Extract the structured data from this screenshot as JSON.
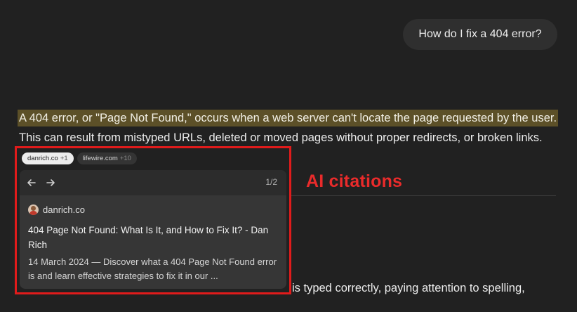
{
  "user_message": "How do I fix a 404 error?",
  "answer": {
    "line1_highlighted": "A 404 error, or \"Page Not Found,\" occurs when a web server can't locate the page requested by the user.",
    "line2": "This can result from mistyped URLs, deleted or moved pages without proper redirects, or broken links.",
    "partial_bottom": "is typed correctly, paying attention to spelling,"
  },
  "citation_chips": [
    {
      "label": "danrich.co",
      "count": "+1"
    },
    {
      "label": "lifewire.com",
      "count": "+10"
    }
  ],
  "citation_card": {
    "pager": "1/2",
    "source": "danrich.co",
    "title": "404 Page Not Found: What Is It, and How to Fix It? - Dan Rich",
    "snippet": "14 March 2024 — Discover what a 404 Page Not Found error is and learn effective strategies to fix it in our ..."
  },
  "annotation": {
    "label": "AI citations",
    "color": "#ea2b2b"
  },
  "icons": {
    "back": "arrow-left-icon",
    "forward": "arrow-right-icon",
    "avatar": "source-favicon"
  }
}
